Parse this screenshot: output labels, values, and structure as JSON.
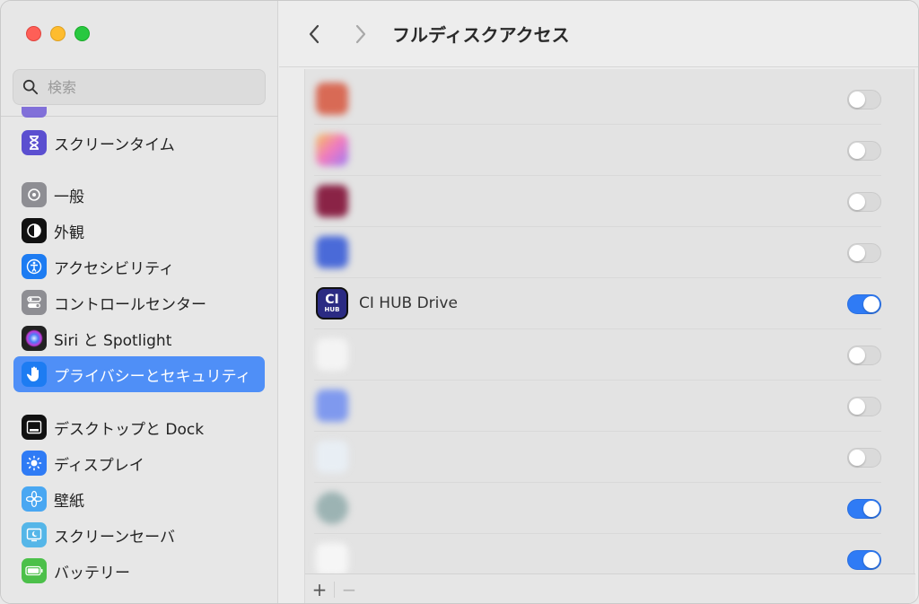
{
  "sidebar": {
    "search": {
      "placeholder": "検索",
      "value": ""
    },
    "items": [
      {
        "label": "スクリーンタイム",
        "icon": "hourglass-icon",
        "color": "#5b4fd0"
      },
      {
        "label": "一般",
        "icon": "gear-icon",
        "color": "#8e8e93"
      },
      {
        "label": "外観",
        "icon": "appearance-icon",
        "color": "#111111"
      },
      {
        "label": "アクセシビリティ",
        "icon": "accessibility-icon",
        "color": "#1d7cf2"
      },
      {
        "label": "コントロールセンター",
        "icon": "control-center-icon",
        "color": "#8e8e93"
      },
      {
        "label": "Siri と Spotlight",
        "icon": "siri-icon",
        "color": "#222222"
      },
      {
        "label": "プライバシーとセキュリティ",
        "icon": "hand-icon",
        "color": "#1d7cf2",
        "selected": true
      },
      {
        "label": "デスクトップと Dock",
        "icon": "dock-icon",
        "color": "#111111"
      },
      {
        "label": "ディスプレイ",
        "icon": "display-icon",
        "color": "#2f7bf5"
      },
      {
        "label": "壁紙",
        "icon": "wallpaper-icon",
        "color": "#49a7f2"
      },
      {
        "label": "スクリーンセーバ",
        "icon": "screensaver-icon",
        "color": "#55b6e8"
      },
      {
        "label": "バッテリー",
        "icon": "battery-icon",
        "color": "#4cc04a"
      }
    ]
  },
  "toolbar": {
    "title": "フルディスクアクセス"
  },
  "apps": [
    {
      "name": "",
      "icon_color": "#d86a55",
      "enabled": false,
      "blurred": true
    },
    {
      "name": "",
      "icon_color": "#f08fb0",
      "enabled": false,
      "blurred": true
    },
    {
      "name": "",
      "icon_color": "#8a2346",
      "enabled": false,
      "blurred": true
    },
    {
      "name": "",
      "icon_color": "#4a6ad8",
      "enabled": false,
      "blurred": true
    },
    {
      "name": "CI HUB Drive",
      "icon_color": "#2b2b83",
      "enabled": true,
      "blurred": false
    },
    {
      "name": "",
      "icon_color": "#f4f4f4",
      "enabled": false,
      "blurred": true
    },
    {
      "name": "",
      "icon_color": "#7f99ee",
      "enabled": false,
      "blurred": true
    },
    {
      "name": "",
      "icon_color": "#e8eef4",
      "enabled": false,
      "blurred": true
    },
    {
      "name": "",
      "icon_color": "#9cb3b3",
      "enabled": true,
      "blurred": true
    },
    {
      "name": "",
      "icon_color": "#f6f6f6",
      "enabled": true,
      "blurred": true
    }
  ],
  "footer": {
    "add_label": "+",
    "remove_label": "−"
  },
  "colors": {
    "accent": "#2f7bf5",
    "selection": "#4f8ff7"
  }
}
